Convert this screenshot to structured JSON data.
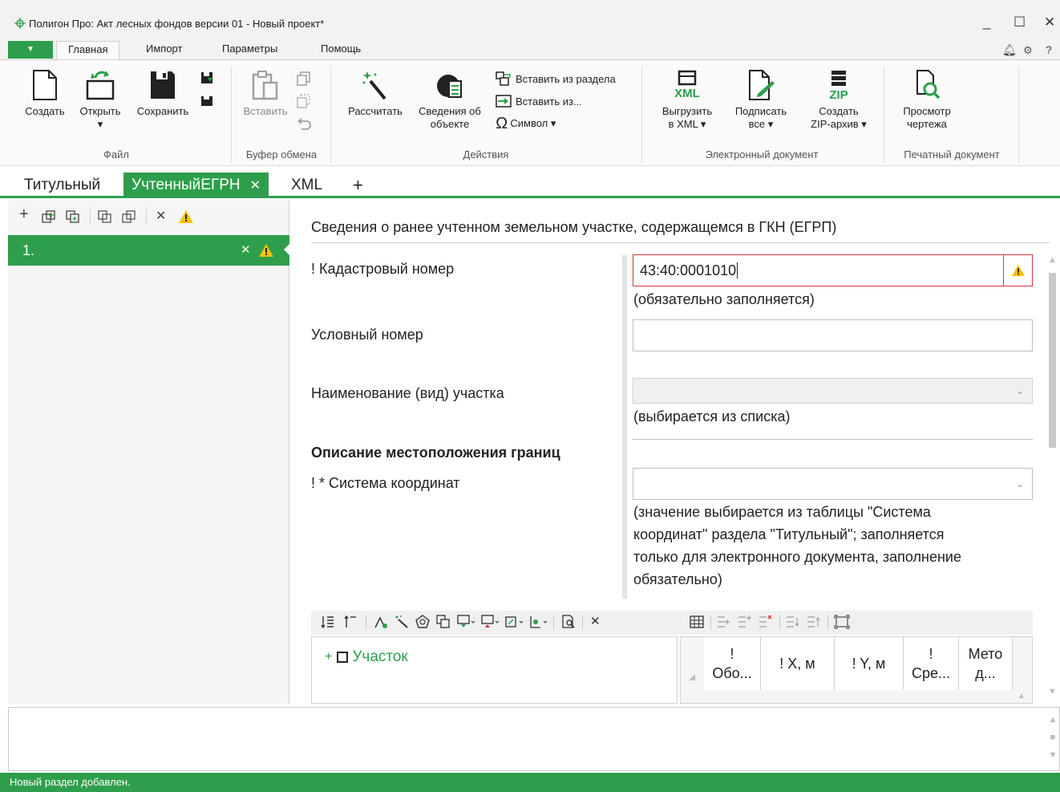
{
  "window": {
    "title": "Полигон Про: Акт лесных фондов версии 01 - Новый проект*",
    "minimize": "_",
    "maximize": "☐",
    "close": "✕"
  },
  "ribbon_tabs": {
    "app_menu": "▼",
    "items": [
      "Главная",
      "Импорт",
      "Параметры",
      "Помощь"
    ],
    "active": "Главная"
  },
  "ribbon": {
    "file": {
      "group_label": "Файл",
      "create": "Создать",
      "open": "Открыть",
      "open_arrow": "▾",
      "save": "Сохранить"
    },
    "clipboard": {
      "group_label": "Буфер обмена",
      "paste": "Вставить"
    },
    "actions": {
      "group_label": "Действия",
      "calculate": "Рассчитать",
      "object_info_1": "Сведения об",
      "object_info_2": "объекте",
      "insert_from_section": "Вставить из раздела",
      "insert_from": "Вставить из...",
      "symbol": "Символ ▾"
    },
    "edoc": {
      "group_label": "Электронный документ",
      "export_xml_1": "Выгрузить",
      "export_xml_2": "в XML ▾",
      "sign_1": "Подписать",
      "sign_2": "все ▾",
      "zip_1": "Создать",
      "zip_2": "ZIP-архив ▾",
      "xml_icon_text": "XML",
      "zip_icon_text": "ZIP"
    },
    "printdoc": {
      "group_label": "Печатный документ",
      "preview_1": "Просмотр",
      "preview_2": "чертежа"
    }
  },
  "doc_tabs": {
    "items": [
      {
        "label": "Титульный"
      },
      {
        "label": "УчтенныйЕГРН",
        "close": "✕"
      },
      {
        "label": "XML"
      }
    ],
    "add": "+",
    "active": "УчтенныйЕГРН"
  },
  "left_panel": {
    "toolbar": {
      "add": "+",
      "delete": "✕"
    },
    "rows": [
      {
        "number": "1.",
        "delete": "✕"
      }
    ]
  },
  "form": {
    "title": "Сведения о ранее учтенном земельном участке, содержащемся в ГКН (ЕГРП)",
    "cadastral_label": "! Кадастровый номер",
    "cadastral_value": "43:40:0001010",
    "cadastral_hint": "(обязательно заполняется)",
    "conditional_label": "Условный номер",
    "conditional_value": "",
    "name_label": "Наименование (вид) участка",
    "name_hint": "(выбирается из списка)",
    "section_title": "Описание местоположения границ",
    "coords_label": "! * Система координат",
    "coords_hint_lines": [
      "(значение выбирается из таблицы \"Система",
      "координат\" раздела \"Титульный\"; заполняется",
      "только для электронного документа, заполнение",
      "обязательно)"
    ],
    "dropdown_caret": "⌄"
  },
  "tree": {
    "plus": "+",
    "item": "Участок"
  },
  "grid": {
    "headers": [
      {
        "line1": "!",
        "line2": "Обо..."
      },
      {
        "line1": "! X, м",
        "line2": ""
      },
      {
        "line1": "! Y, м",
        "line2": ""
      },
      {
        "line1": "!",
        "line2": "Сре..."
      },
      {
        "line1": "Мето",
        "line2": "д..."
      }
    ]
  },
  "scroll": {
    "up": "▲",
    "down": "▼",
    "mid": "■"
  },
  "status": {
    "text": "Новый раздел добавлен."
  },
  "colors": {
    "accent": "#2e9e4c",
    "warning": "#f2c200",
    "error_border": "#d9363e"
  }
}
